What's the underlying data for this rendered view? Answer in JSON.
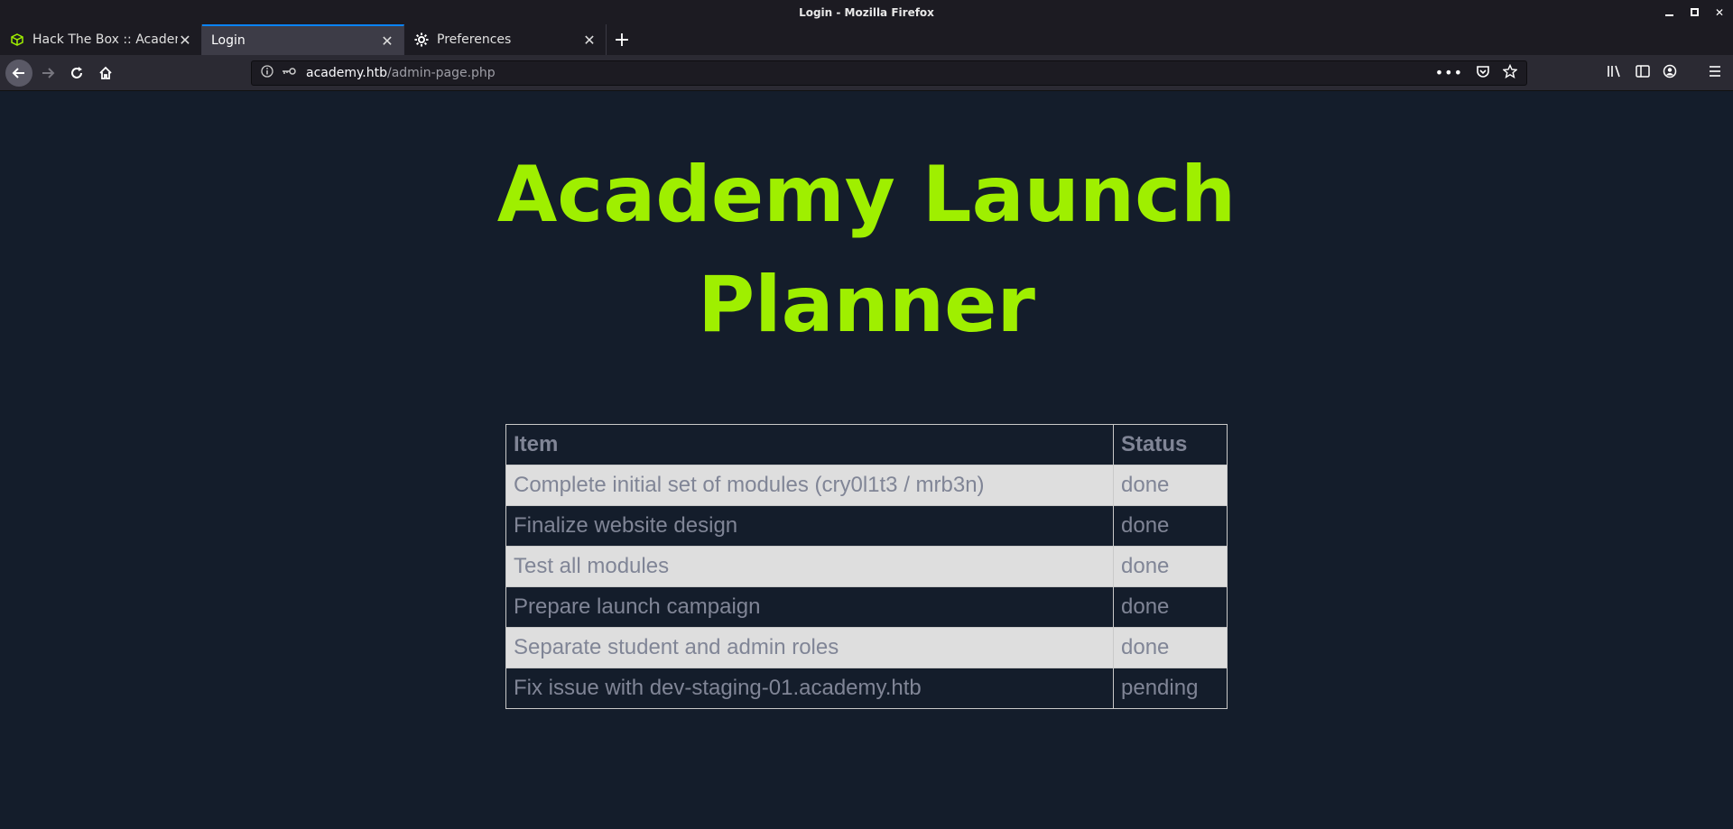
{
  "window": {
    "title": "Login - Mozilla Firefox"
  },
  "tabs": [
    {
      "label": "Hack The Box :: Academy",
      "icon": "htb-cube-icon",
      "active": false
    },
    {
      "label": "Login",
      "icon": "",
      "active": true
    },
    {
      "label": "Preferences",
      "icon": "gear-icon",
      "active": false
    }
  ],
  "urlbar": {
    "host": "academy.htb",
    "path": "/admin-page.php"
  },
  "page": {
    "title_line1": "Academy Launch",
    "title_line2": "Planner",
    "table": {
      "headers": [
        "Item",
        "Status"
      ],
      "rows": [
        {
          "item": "Complete initial set of modules (cry0l1t3 / mrb3n)",
          "status": "done"
        },
        {
          "item": "Finalize website design",
          "status": "done"
        },
        {
          "item": "Test all modules",
          "status": "done"
        },
        {
          "item": "Prepare launch campaign",
          "status": "done"
        },
        {
          "item": "Separate student and admin roles",
          "status": "done"
        },
        {
          "item": "Fix issue with dev-staging-01.academy.htb",
          "status": "pending"
        }
      ]
    }
  },
  "colors": {
    "accent": "#9fef00",
    "background": "#141d2b",
    "tab_highlight": "#0a84ff"
  }
}
